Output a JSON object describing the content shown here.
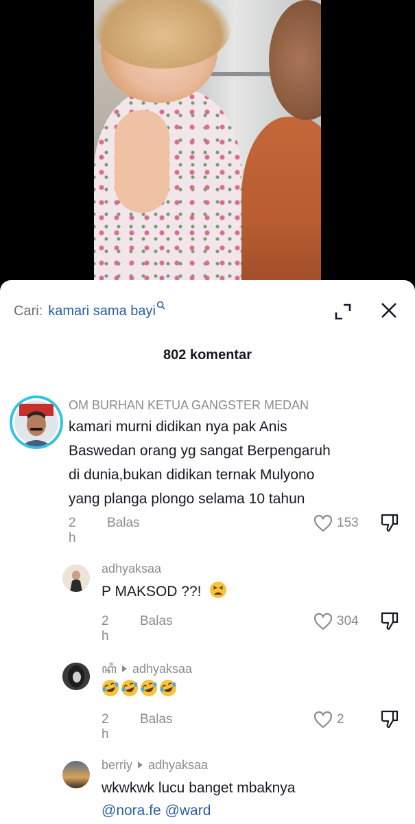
{
  "search": {
    "prefix": "Cari:",
    "term": "kamari sama bayi"
  },
  "comments_header": {
    "count_label": "802 komentar"
  },
  "comments": [
    {
      "username": "OM BURHAN KETUA GANGSTER MEDAN",
      "lines": [
        "kamari murni didikan nya pak Anis",
        "Baswedan orang yg sangat Berpengaruh",
        "di dunia,bukan didikan ternak Mulyono",
        "yang planga plongo selama 10 tahun"
      ],
      "time": "2 h",
      "reply_label": "Balas",
      "likes": "153"
    },
    {
      "username": "adhyaksaa",
      "text": "P MAKSOD ??!",
      "emoji": "tired-face-emoji",
      "time": "2 h",
      "reply_label": "Balas",
      "likes": "304"
    },
    {
      "username": "ꦏꦶ",
      "reply_to": "adhyaksaa",
      "emoji": "rolling-laughing-emoji",
      "emoji_count": 4,
      "time": "2 h",
      "reply_label": "Balas",
      "likes": "2"
    },
    {
      "username": "berriy",
      "reply_to": "adhyaksaa",
      "text": "wkwkwk lucu banget mbaknya",
      "mentions": [
        "@nora.fe",
        "@ward"
      ]
    }
  ],
  "colors": {
    "link": "#2c5ea8",
    "muted": "#8a8b91",
    "text": "#161823",
    "avatar_ring": "#2ec3e6"
  }
}
